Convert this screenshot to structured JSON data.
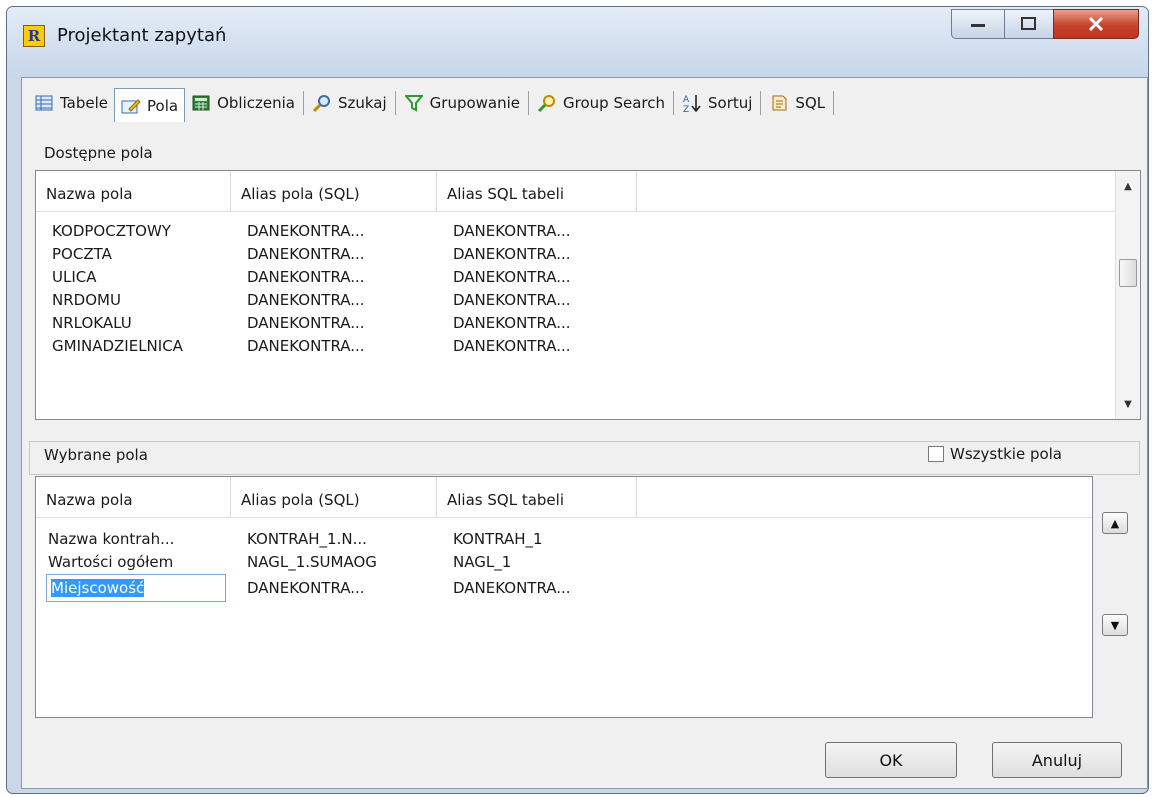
{
  "window": {
    "title": "Projektant zapytań",
    "app_icon_letter": "R"
  },
  "toolbar": {
    "items": [
      {
        "label": "Tabele",
        "icon": "table-icon"
      },
      {
        "label": "Pola",
        "icon": "fields-edit-icon"
      },
      {
        "label": "Obliczenia",
        "icon": "calculator-icon"
      },
      {
        "label": "Szukaj",
        "icon": "magnifier-icon"
      },
      {
        "label": "Grupowanie",
        "icon": "funnel-icon"
      },
      {
        "label": "Group Search",
        "icon": "group-search-icon"
      },
      {
        "label": "Sortuj",
        "icon": "sort-az-icon"
      },
      {
        "label": "SQL",
        "icon": "sql-script-icon"
      }
    ],
    "active_index": 1
  },
  "available": {
    "label": "Dostępne pola",
    "columns": [
      "Nazwa pola",
      "Alias pola (SQL)",
      "Alias SQL tabeli"
    ],
    "rows": [
      [
        "KODPOCZTOWY",
        "DANEKONTRA...",
        "DANEKONTRA..."
      ],
      [
        "POCZTA",
        "DANEKONTRA...",
        "DANEKONTRA..."
      ],
      [
        "ULICA",
        "DANEKONTRA...",
        "DANEKONTRA..."
      ],
      [
        "NRDOMU",
        "DANEKONTRA...",
        "DANEKONTRA..."
      ],
      [
        "NRLOKALU",
        "DANEKONTRA...",
        "DANEKONTRA..."
      ],
      [
        "GMINADZIELNICA",
        "DANEKONTRA...",
        "DANEKONTRA..."
      ]
    ]
  },
  "selected": {
    "label": "Wybrane pola",
    "all_fields_label": "Wszystkie pola",
    "all_fields_checked": false,
    "columns": [
      "Nazwa pola",
      "Alias pola (SQL)",
      "Alias SQL tabeli"
    ],
    "rows": [
      [
        "Nazwa kontrah...",
        "KONTRAH_1.N...",
        "KONTRAH_1"
      ],
      [
        "Wartości ogółem",
        "NAGL_1.SUMAOG",
        "NAGL_1"
      ],
      [
        "Miejscowość",
        "DANEKONTRA...",
        "DANEKONTRA..."
      ]
    ],
    "editing_value": "Miejscowość"
  },
  "buttons": {
    "ok": "OK",
    "cancel": "Anuluj"
  }
}
